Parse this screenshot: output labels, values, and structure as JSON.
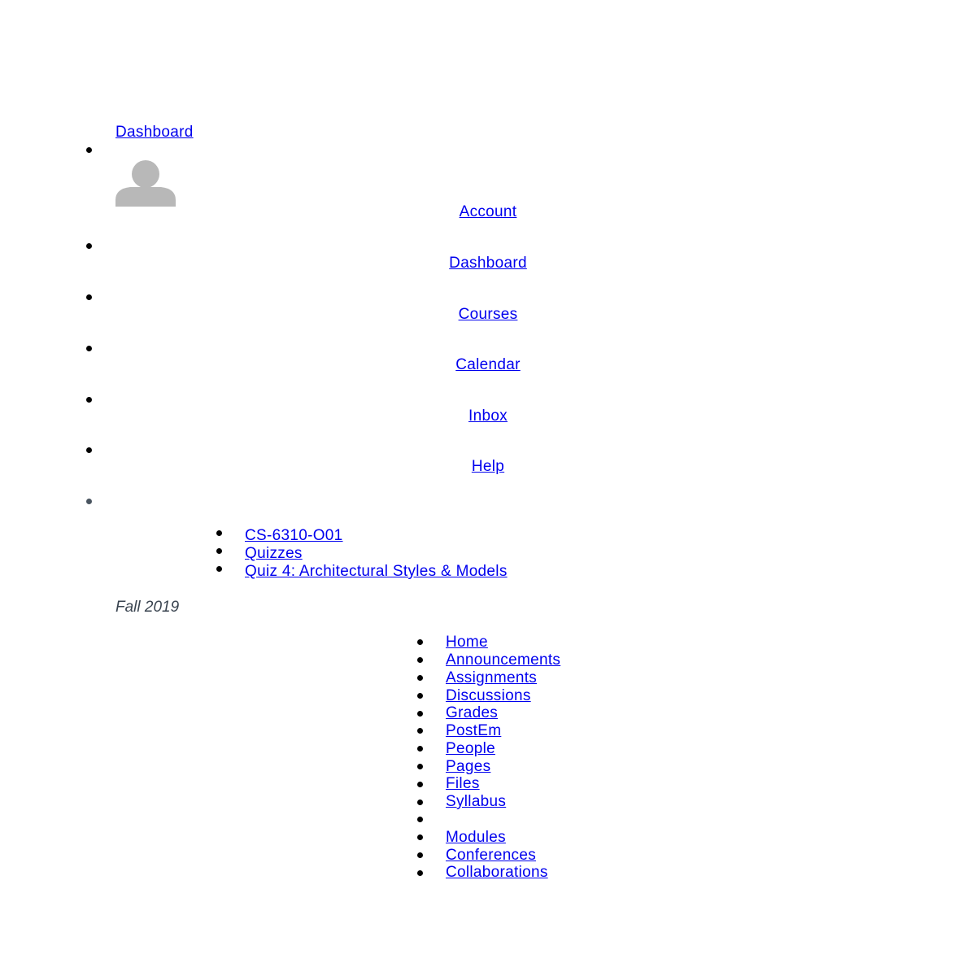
{
  "header": {
    "dashboard_link": "Dashboard"
  },
  "global_nav": {
    "items": [
      {
        "label": "Account"
      },
      {
        "label": "Dashboard"
      },
      {
        "label": "Courses"
      },
      {
        "label": "Calendar"
      },
      {
        "label": "Inbox"
      },
      {
        "label": "Help"
      }
    ]
  },
  "breadcrumb": {
    "items": [
      {
        "label": "CS-6310-O01"
      },
      {
        "label": "Quizzes"
      },
      {
        "label": "Quiz 4: Architectural Styles & Models"
      }
    ]
  },
  "course": {
    "term": "Fall 2019"
  },
  "course_nav": {
    "items": [
      {
        "label": "Home"
      },
      {
        "label": "Announcements"
      },
      {
        "label": "Assignments"
      },
      {
        "label": "Discussions"
      },
      {
        "label": "Grades"
      },
      {
        "label": "PostEm"
      },
      {
        "label": "People"
      },
      {
        "label": "Pages"
      },
      {
        "label": "Files"
      },
      {
        "label": "Syllabus"
      },
      {
        "label": ""
      },
      {
        "label": "Modules"
      },
      {
        "label": "Conferences"
      },
      {
        "label": "Collaborations"
      }
    ]
  },
  "colors": {
    "link": "#0000ee",
    "avatar": "#b8b8b8",
    "term_text": "#3a4450"
  },
  "icons": {
    "avatar": "user-silhouette-icon"
  }
}
